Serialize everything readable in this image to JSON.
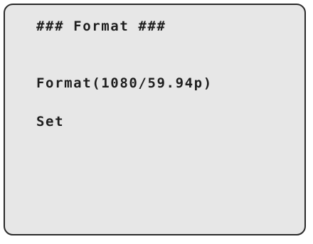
{
  "menu": {
    "title": "### Format ###",
    "items": [
      {
        "label": "Format(1080/59.94p)"
      },
      {
        "label": "Set"
      }
    ]
  },
  "colors": {
    "background": "#e7e7e7",
    "border": "#2a2a2a",
    "text": "#1e1e1e"
  }
}
